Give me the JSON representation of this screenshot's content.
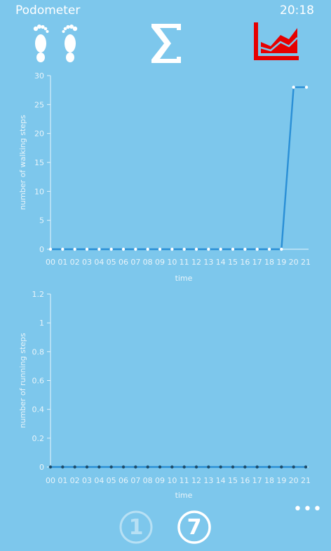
{
  "app": {
    "title": "Podometer",
    "time": "20:18"
  },
  "nav": {
    "items": [
      {
        "icon": "footprints-icon",
        "active": false
      },
      {
        "icon": "sigma-icon",
        "active": false
      },
      {
        "icon": "area-chart-icon",
        "active": true
      }
    ],
    "active_color": "#e60000"
  },
  "charts": {
    "line_color": "#2a8fd6",
    "axis_color": "#e6f4fb",
    "label_color": "#e8f4fa"
  },
  "chart_data": [
    {
      "type": "line",
      "ylabel": "number of walking steps",
      "xlabel": "time",
      "categories": [
        "00",
        "01",
        "02",
        "03",
        "04",
        "05",
        "06",
        "07",
        "08",
        "09",
        "10",
        "11",
        "12",
        "13",
        "14",
        "15",
        "16",
        "17",
        "18",
        "19",
        "20",
        "21"
      ],
      "values": [
        0,
        0,
        0,
        0,
        0,
        0,
        0,
        0,
        0,
        0,
        0,
        0,
        0,
        0,
        0,
        0,
        0,
        0,
        0,
        0,
        28,
        28
      ],
      "ylim": [
        0,
        30
      ],
      "yticks": [
        0,
        5,
        10,
        15,
        20,
        25,
        30
      ]
    },
    {
      "type": "line",
      "ylabel": "number of running steps",
      "xlabel": "time",
      "categories": [
        "00",
        "01",
        "02",
        "03",
        "04",
        "05",
        "06",
        "07",
        "08",
        "09",
        "10",
        "11",
        "12",
        "13",
        "14",
        "15",
        "16",
        "17",
        "18",
        "19",
        "20",
        "21"
      ],
      "values": [
        0,
        0,
        0,
        0,
        0,
        0,
        0,
        0,
        0,
        0,
        0,
        0,
        0,
        0,
        0,
        0,
        0,
        0,
        0,
        0,
        0,
        0
      ],
      "ylim": [
        0,
        1.2
      ],
      "yticks": [
        "0",
        "0.2",
        "0.4",
        "0.6",
        "0.8",
        "1",
        "1.2"
      ]
    }
  ],
  "bottom": {
    "buttons": [
      {
        "label": "1"
      },
      {
        "label": "7"
      }
    ],
    "more": "•••"
  }
}
